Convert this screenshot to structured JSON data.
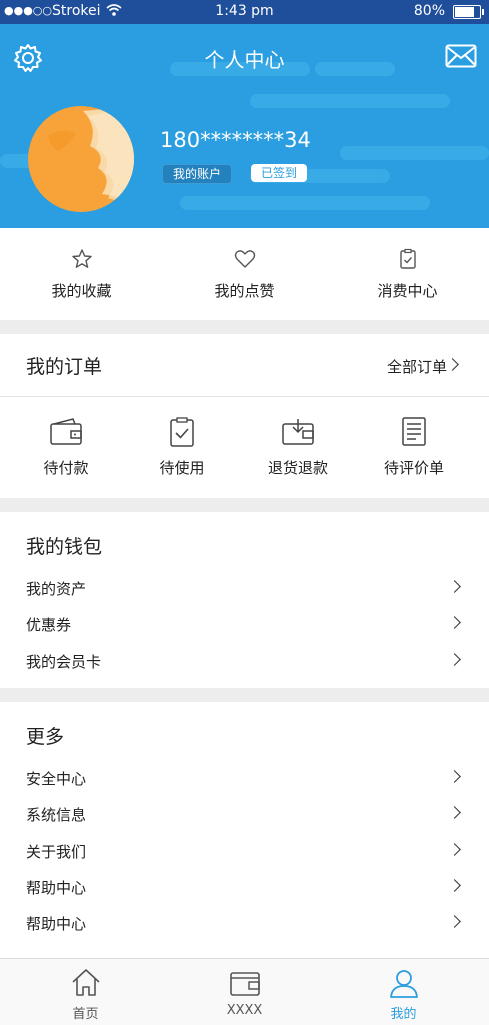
{
  "status_bar": {
    "signal": "●●●○○",
    "carrier": "Strokei",
    "time": "1:43 pm",
    "battery": "80%"
  },
  "header": {
    "title": "个人中心",
    "phone": "180********34",
    "account_badge": "我的账户",
    "signed_badge": "已签到",
    "bg_color": "#2a9ee0"
  },
  "quick_actions": [
    {
      "label": "我的收藏",
      "icon": "star-icon"
    },
    {
      "label": "我的点赞",
      "icon": "heart-icon"
    },
    {
      "label": "消费中心",
      "icon": "clipboard-icon"
    }
  ],
  "orders": {
    "title": "我的订单",
    "all_label": "全部订单",
    "items": [
      {
        "label": "待付款",
        "icon": "wallet-icon"
      },
      {
        "label": "待使用",
        "icon": "clipboard-check-icon"
      },
      {
        "label": "退货退款",
        "icon": "return-icon"
      },
      {
        "label": "待评价单",
        "icon": "document-icon"
      }
    ]
  },
  "wallet": {
    "title": "我的钱包",
    "rows": [
      "我的资产",
      "优惠券",
      "我的会员卡"
    ]
  },
  "more": {
    "title": "更多",
    "rows": [
      "安全中心",
      "系统信息",
      "关于我们",
      "帮助中心",
      "帮助中心"
    ]
  },
  "tabbar": {
    "tabs": [
      {
        "label": "首页",
        "icon": "home-icon"
      },
      {
        "label": "XXXX",
        "icon": "wallet-icon"
      },
      {
        "label": "我的",
        "icon": "user-icon"
      }
    ],
    "active_color": "#2a9ee0"
  }
}
